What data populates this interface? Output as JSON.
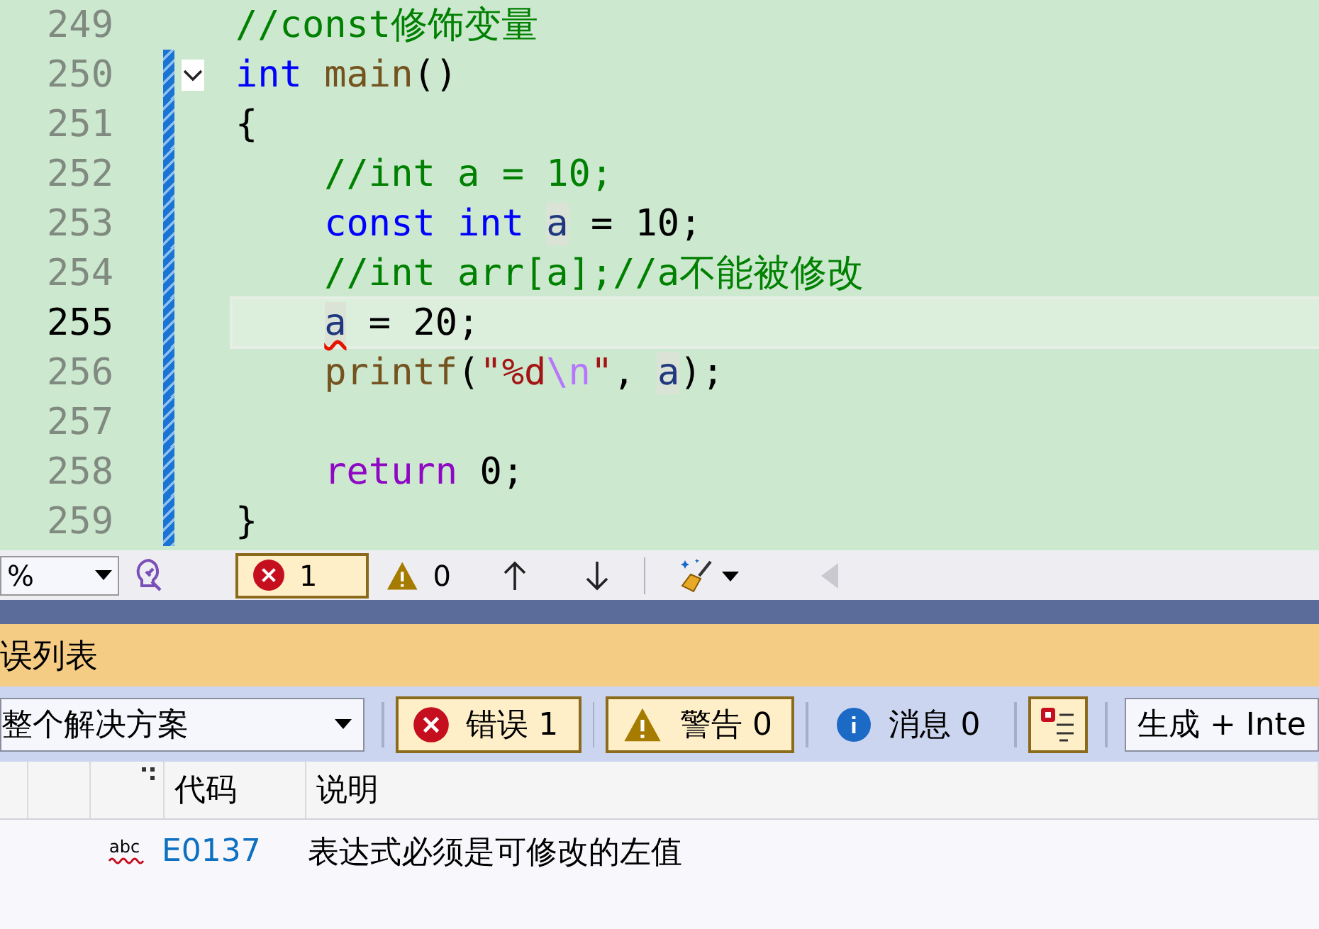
{
  "editor": {
    "lines": [
      {
        "number": "249",
        "current": false,
        "changed": false,
        "indented": false,
        "tokens": [
          {
            "text": "//const修饰变量",
            "kind": "comment"
          }
        ]
      },
      {
        "number": "250",
        "current": false,
        "changed": true,
        "indented": false,
        "expanded": true,
        "tokens": [
          {
            "text": "int ",
            "kind": "keyword"
          },
          {
            "text": "main",
            "kind": "function"
          },
          {
            "text": "()",
            "kind": "plain"
          }
        ]
      },
      {
        "number": "251",
        "current": false,
        "changed": true,
        "indented": false,
        "tokens": [
          {
            "text": "{",
            "kind": "plain"
          }
        ]
      },
      {
        "number": "252",
        "current": false,
        "changed": true,
        "indented": true,
        "tokens": [
          {
            "text": "//int a = 10;",
            "kind": "comment"
          }
        ]
      },
      {
        "number": "253",
        "current": false,
        "changed": true,
        "indented": true,
        "tokens": [
          {
            "text": "const int ",
            "kind": "keyword"
          },
          {
            "text": "a",
            "kind": "variable",
            "highlighted": true
          },
          {
            "text": " = ",
            "kind": "plain"
          },
          {
            "text": "10",
            "kind": "number"
          },
          {
            "text": ";",
            "kind": "plain"
          }
        ]
      },
      {
        "number": "254",
        "current": false,
        "changed": true,
        "indented": true,
        "tokens": [
          {
            "text": "//int arr[a];//a不能被修改",
            "kind": "comment"
          }
        ]
      },
      {
        "number": "255",
        "current": true,
        "changed": true,
        "indented": true,
        "tokens": [
          {
            "text": "a",
            "kind": "variable",
            "highlighted": true,
            "error": true
          },
          {
            "text": " = ",
            "kind": "plain"
          },
          {
            "text": "20",
            "kind": "number"
          },
          {
            "text": ";",
            "kind": "plain"
          }
        ]
      },
      {
        "number": "256",
        "current": false,
        "changed": true,
        "indented": true,
        "tokens": [
          {
            "text": "printf",
            "kind": "function"
          },
          {
            "text": "(",
            "kind": "plain"
          },
          {
            "text": "\"%d",
            "kind": "string"
          },
          {
            "text": "\\n",
            "kind": "escape"
          },
          {
            "text": "\"",
            "kind": "string"
          },
          {
            "text": ", ",
            "kind": "plain"
          },
          {
            "text": "a",
            "kind": "variable",
            "highlighted": true
          },
          {
            "text": ");",
            "kind": "plain"
          }
        ]
      },
      {
        "number": "257",
        "current": false,
        "changed": true
      },
      {
        "number": "258",
        "current": false,
        "changed": true,
        "indented": true,
        "tokens": [
          {
            "text": "return ",
            "kind": "control"
          },
          {
            "text": "0",
            "kind": "number"
          },
          {
            "text": ";",
            "kind": "plain"
          }
        ]
      },
      {
        "number": "259",
        "current": false,
        "changed": true,
        "indented": false,
        "tokens": [
          {
            "text": "}",
            "kind": "plain"
          }
        ]
      }
    ]
  },
  "editor_toolbar": {
    "zoom": "%",
    "errors": {
      "count": "1",
      "selected": true
    },
    "warnings": {
      "count": "0",
      "selected": false
    }
  },
  "error_list": {
    "title": "误列表",
    "scope": "整个解决方案",
    "filters": [
      {
        "kind": "error",
        "label": "错误 1",
        "selected": true
      },
      {
        "kind": "warning",
        "label": "警告 0",
        "selected": true
      },
      {
        "kind": "info",
        "label": "消息 0",
        "selected": false
      }
    ],
    "filter_toggle_selected": true,
    "source": "生成 + Inte",
    "columns": [
      "代码",
      "说明"
    ],
    "rows": [
      {
        "icon_label": "abc",
        "code": "E0137",
        "description": "表达式必须是可修改的左值"
      }
    ]
  }
}
